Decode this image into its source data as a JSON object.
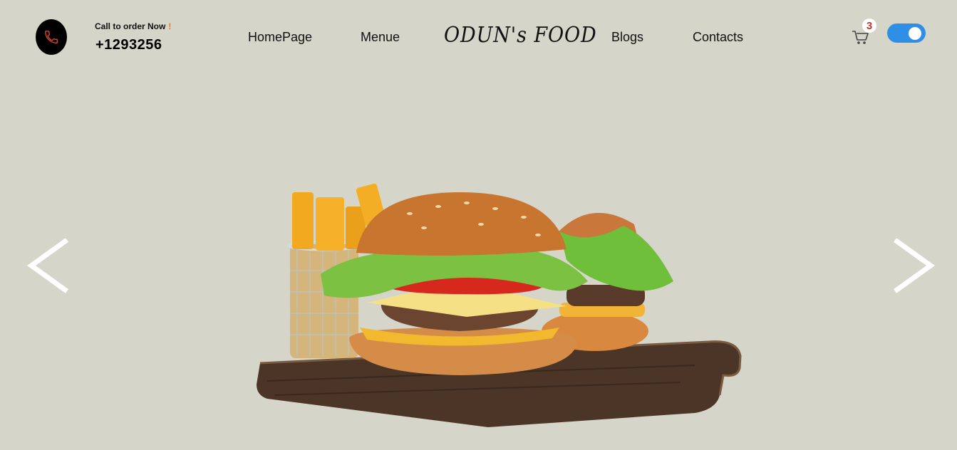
{
  "header": {
    "call_label": "Call to order Now",
    "call_exclaim": "!",
    "phone_number": "+1293256",
    "brand": "ODUN's FOOD",
    "nav": [
      "HomePage",
      "Menue",
      "Blogs",
      "Contacts"
    ],
    "cart_count": "3",
    "theme_toggle_on": true
  },
  "colors": {
    "background": "#d5d5c9",
    "toggle": "#2f8fe6",
    "badge_text": "#c0392b",
    "phone_icon": "#e0442c"
  },
  "icons": {
    "phone": "phone-icon",
    "cart": "cart-icon",
    "prev": "chevron-left-icon",
    "next": "chevron-right-icon"
  }
}
